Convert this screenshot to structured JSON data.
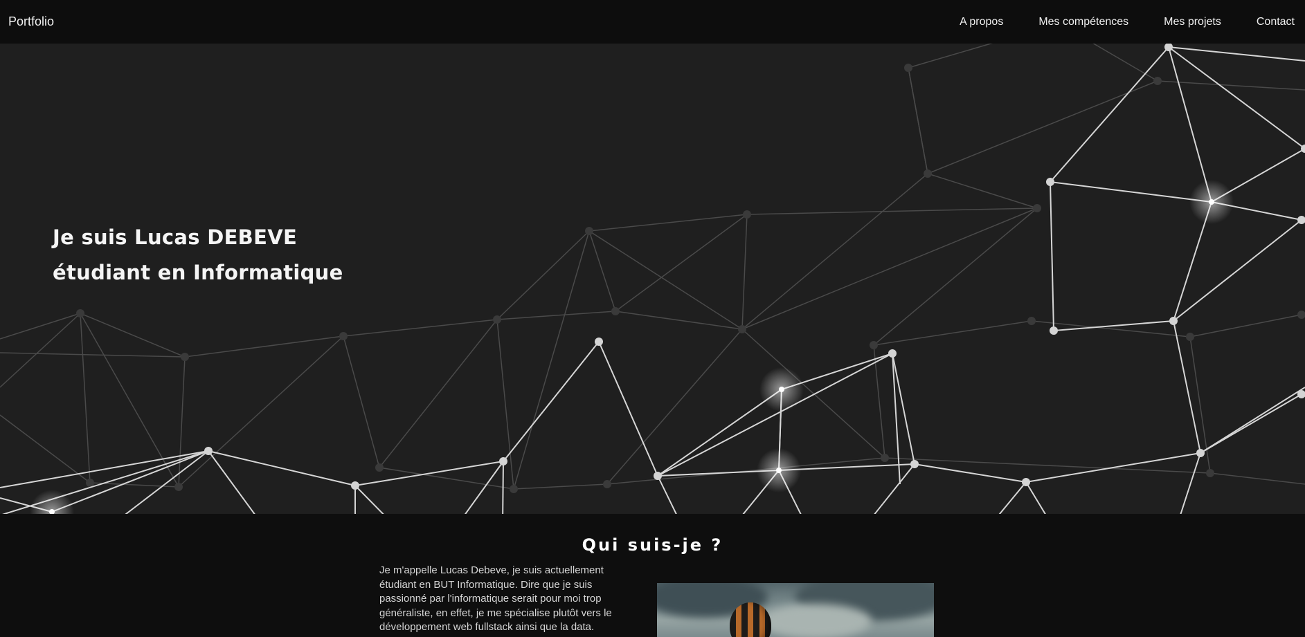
{
  "nav": {
    "brand": "Portfolio",
    "links": [
      {
        "label": "A propos"
      },
      {
        "label": "Mes compétences"
      },
      {
        "label": "Mes projets"
      },
      {
        "label": "Contact"
      }
    ]
  },
  "hero": {
    "line1": "Je suis Lucas DEBEVE",
    "line2": "étudiant en Informatique"
  },
  "about": {
    "title": "Qui suis-je ?",
    "text": "Je m'appelle Lucas Debeve, je suis actuellement étudiant en BUT Informatique. Dire que je suis passionné par l'informatique serait pour moi trop généraliste, en effet, je me spécialise plutôt vers le développement web fullstack ainsi que la data.",
    "image_name": "hot-air-balloon-photo"
  },
  "colors": {
    "navbar": "#0d0d0d",
    "hero_background": "#1f1f1f",
    "page_background": "#0e0e0e",
    "network_dim": "#4a4a4a",
    "network_bright": "#d9d9d9"
  }
}
